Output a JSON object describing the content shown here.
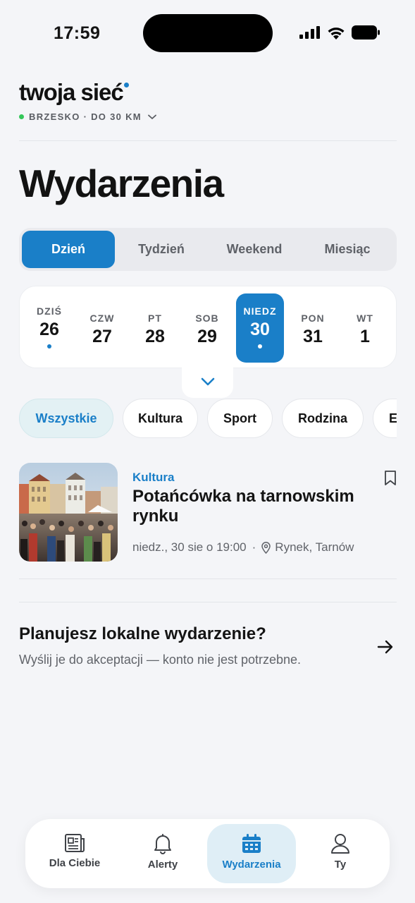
{
  "status_bar": {
    "time": "17:59"
  },
  "header": {
    "brand": "twoja sieć",
    "location": "BRZESKO · DO 30 KM"
  },
  "page_title": "Wydarzenia",
  "segmented": [
    "Dzień",
    "Tydzień",
    "Weekend",
    "Miesiąc"
  ],
  "days": [
    {
      "name": "DZIŚ",
      "num": "26"
    },
    {
      "name": "CZW",
      "num": "27"
    },
    {
      "name": "PT",
      "num": "28"
    },
    {
      "name": "SOB",
      "num": "29"
    },
    {
      "name": "NIEDZ",
      "num": "30"
    },
    {
      "name": "PON",
      "num": "31"
    },
    {
      "name": "WT",
      "num": "1"
    }
  ],
  "chips": [
    "Wszystkie",
    "Kultura",
    "Sport",
    "Rodzina",
    "E"
  ],
  "event": {
    "category": "Kultura",
    "title": "Potańcówka na tarnowskim rynku",
    "datetime": "niedz., 30 sie o 19:00",
    "separator": "·",
    "place": "Rynek, Tarnów"
  },
  "promo": {
    "title": "Planujesz lokalne wydarzenie?",
    "subtitle": "Wyślij je do akceptacji — konto nie jest potrzebne."
  },
  "nav": [
    "Dla Ciebie",
    "Alerty",
    "Wydarzenia",
    "Ty"
  ],
  "colors": {
    "accent": "#1a7fc8",
    "location_dot": "#34c759"
  }
}
